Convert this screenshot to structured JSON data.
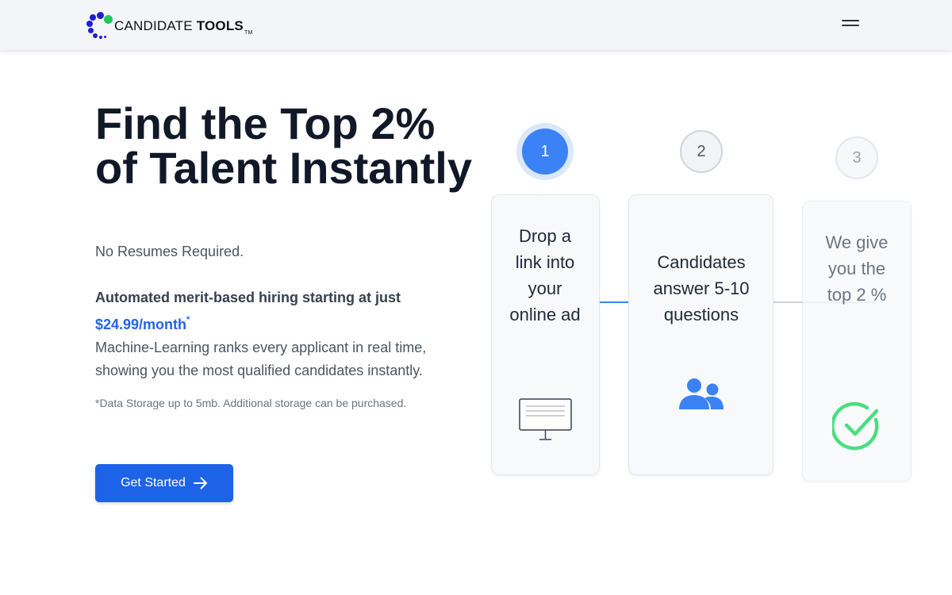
{
  "header": {
    "logo_brand": "CANDIDATE",
    "logo_brand_bold": "TOOLS",
    "logo_tm": "TM",
    "logo_colors": [
      "#1f1fd1",
      "#22c55e"
    ],
    "menu_icon": "hamburger-menu-icon"
  },
  "hero": {
    "title": "Find the Top 2% of Talent Instantly",
    "subtitle": "No Resumes Required.",
    "promo_text": "Automated merit-based hiring starting at just",
    "price": "$24.99/month",
    "price_marker": "*",
    "description": "Machine-Learning ranks every applicant in real time, showing you the most qualified candidates instantly.",
    "footnote": "*Data Storage up to 5mb. Additional storage can be purchased.",
    "cta_label": "Get Started",
    "cta_icon": "arrow-right-icon"
  },
  "steps": [
    {
      "number": "1",
      "text": "Drop a link into your online ad",
      "icon": "monitor-icon",
      "active": true
    },
    {
      "number": "2",
      "text": "Candidates answer 5-10 questions",
      "icon": "users-icon",
      "active": false
    },
    {
      "number": "3",
      "text": "We give you the top 2 %",
      "icon": "check-circle-icon",
      "active": false
    }
  ],
  "colors": {
    "accent": "#2563eb",
    "step_active": "#3b82f6",
    "check_green": "#4ade80",
    "header_bg": "#f3f5f9"
  }
}
